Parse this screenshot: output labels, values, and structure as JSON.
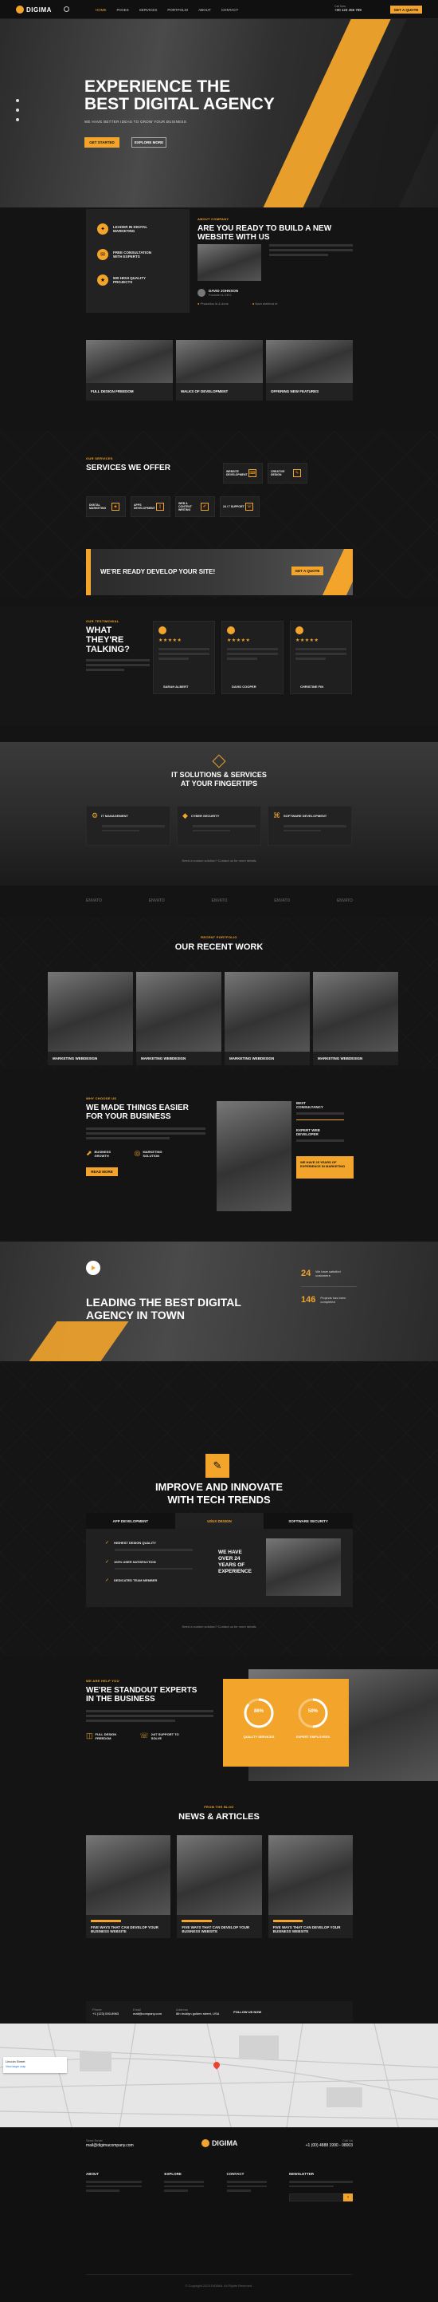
{
  "header": {
    "logo": "DIGIMA",
    "nav": [
      "HOME",
      "PAGES",
      "SERVICES",
      "PORTFOLIO",
      "ABOUT",
      "CONTACT"
    ],
    "phone_label": "Call Now",
    "phone": "+00 123 456 789",
    "cta": "GET A QUOTE"
  },
  "hero": {
    "title_line1": "EXPERIENCE THE",
    "title_line2": "BEST DIGITAL AGENCY",
    "subtitle": "WE HAVE BETTER IDEAS TO GROW YOUR BUSINESS",
    "btn_primary": "GET STARTED",
    "btn_secondary": "EXPLORE MORE"
  },
  "features": {
    "items": [
      "LEADER IN DIGITAL MARKETING",
      "FREE CONSULTATION WITH EXPERTS",
      "500 HIGH QUALITY PROJECTS"
    ]
  },
  "about": {
    "label": "ABOUT COMPANY",
    "title_line1": "ARE YOU READY TO BUILD A NEW",
    "title_line2": "WEBSITE WITH US",
    "person": "DAVID JOHNSON",
    "person_role": "Founder & CEO",
    "check1": "Phasellus id & done",
    "check2": "Nam eleifend et"
  },
  "gallery": {
    "captions": [
      "FULL DESIGN FREEDOM",
      "WALKS OF DEVELOPMENT",
      "OFFERING NEW FEATURES"
    ]
  },
  "services": {
    "label": "OUR SERVICES",
    "title": "SERVICES WE OFFER",
    "items": [
      "WEBSITE DEVELOPMENT",
      "CREATIVE DESIGN",
      "DIGITAL MARKETING",
      "APPS DEVELOPMENT",
      "WEB & CONTENT WRITING",
      "24 / 7 SUPPORT"
    ]
  },
  "cta_banner": {
    "title": "WE'RE READY DEVELOP YOUR SITE!",
    "btn": "GET A QUOTE"
  },
  "testimonials": {
    "label": "OUR TESTIMONIAL",
    "title_line1": "WHAT THEY'RE",
    "title_line2": "TALKING?",
    "people": [
      "SARAH ALBERT",
      "DAVID COOPER",
      "CHRISTINE FIN"
    ],
    "stars": "★★★★★"
  },
  "solutions": {
    "title_line1": "IT SOLUTIONS & SERVICES",
    "title_line2": "AT YOUR FINGERTIPS",
    "items": [
      "IT MANAGEMENT",
      "CYBER SECURITY",
      "SOFTWARE DEVELOPMENT"
    ],
    "note": "Need a custom solution? Contact us for more details"
  },
  "brands": {
    "items": [
      "ENVATO",
      "ENVATO",
      "ENVATO",
      "ENVATO",
      "ENVATO"
    ]
  },
  "work": {
    "label": "RECENT PORTFOLIO",
    "title": "OUR RECENT WORK",
    "captions": [
      "MARKETING WEBDESIGN",
      "MARKETING WEBDESIGN",
      "MARKETING WEBDESIGN",
      "MARKETING WEBDESIGN"
    ]
  },
  "why": {
    "label": "WHY CHOOSE US",
    "title_line1": "WE MADE THINGS EASIER",
    "title_line2": "FOR YOUR BUSINESS",
    "f1": "BUSINESS GROWTH",
    "f2": "MARKETING SOLUTION",
    "btn": "READ MORE",
    "side1": "BEST CONSULTANCY",
    "side2": "EXPERT WEB DEVELOPER",
    "side_box": "WE HAVE 25 YEARS OF EXPERIENCE IN MARKETING"
  },
  "leading": {
    "title_line1": "LEADING THE BEST DIGITAL",
    "title_line2": "AGENCY IN TOWN",
    "stat1_num": "24",
    "stat1_text": "We have satisfied customers",
    "stat2_num": "146",
    "stat2_text": "Projects has been completed"
  },
  "innovate": {
    "title_line1": "IMPROVE AND INNOVATE",
    "title_line2": "WITH TECH TRENDS",
    "tabs": [
      "APP DEVELOPMENT",
      "UI/UX DESIGN",
      "SOFTWARE SECURITY"
    ],
    "checks": [
      "HIGHEST DESIGN QUALITY",
      "100% USER SATISFACTION",
      "DEDICATED TEAM MEMBER"
    ],
    "exp": "WE HAVE OVER 24 YEARS OF EXPERIENCE",
    "note": "Need a custom solution? Contact us for more details"
  },
  "experts": {
    "label": "WE ARE HELP YOU",
    "title_line1": "WE'RE STANDOUT EXPERTS",
    "title_line2": "IN THE BUSINESS",
    "f1": "FULL DESIGN FREEDOM",
    "f2": "24/7 SUPPORT TO SOLVE",
    "pct1": "86%",
    "pct1_label": "QUALITY SERVICES",
    "pct2": "50%",
    "pct2_label": "EXPERT EMPLOYEES",
    "pct1_value": 0.86,
    "pct2_value": 0.5
  },
  "news": {
    "label": "FROM THE BLOG",
    "title": "NEWS & ARTICLES",
    "items": [
      "FIVE WAYS THAT CAN DEVELOP YOUR BUSINESS WEBSITE",
      "FIVE WAYS THAT CAN DEVELOP YOUR BUSINESS WEBSITE",
      "FIVE WAYS THAT CAN DEVELOP YOUR BUSINESS WEBSITE"
    ]
  },
  "contact": {
    "phone_label": "Phone",
    "phone": "+1 (123) 000-8963",
    "email_label": "Email",
    "email": "mail@company.com",
    "addr_label": "Address",
    "addr": "8th broklyn golden street, USA",
    "follow": "FOLLOW US NOW",
    "map_place": "Lincoln Street",
    "map_link": "View larger map"
  },
  "footer": {
    "email_label": "Send Email",
    "email": "mail@digimacompany.com",
    "logo": "DIGIMA",
    "call_label": "Call Us",
    "call": "+1 (00) 4888 1990 - 08003",
    "cols": [
      "ABOUT",
      "EXPLORE",
      "CONTACT",
      "NEWSLETTER"
    ],
    "copyright": "© Copyright 2023 DIGIMA. All Rights Reserved."
  }
}
